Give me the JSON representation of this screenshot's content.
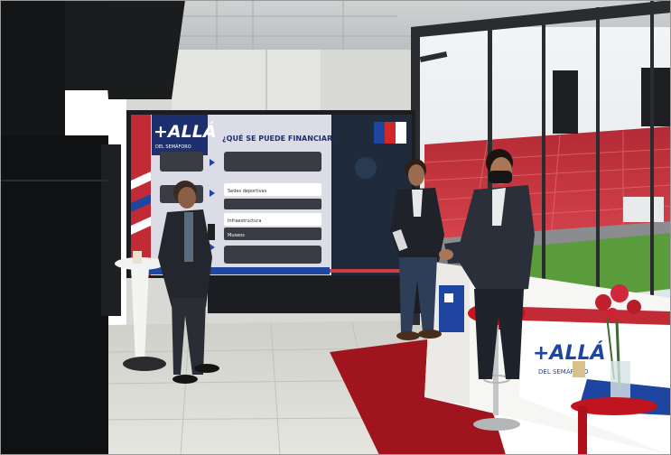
{
  "photo": {
    "screen": {
      "headline": "¿QUÉ SE PUEDE FINANCIAR?",
      "logo_text": "+ALLÁ",
      "logo_subtext": "DEL SEMÁFORO",
      "list_items": [
        "Sedes deportivas",
        "Infraestructura",
        "Museos"
      ]
    },
    "banner": {
      "logo_text": "+ALLÁ",
      "logo_subtext": "DEL SEMÁFORO"
    },
    "colors": {
      "stadium_seats": "#c8323c",
      "carpet": "#a0141e",
      "screen_bg": "#dcdce6",
      "screen_accent": "#d23c3c",
      "chile_blue": "#1e46a0",
      "chile_red": "#d22828",
      "pitch_green": "#5a9b3c"
    }
  }
}
